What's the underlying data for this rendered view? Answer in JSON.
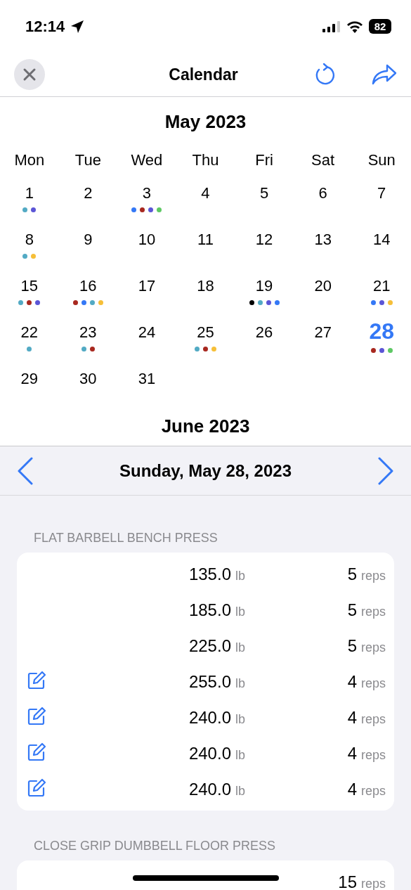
{
  "status_bar": {
    "time": "12:14",
    "battery": "82"
  },
  "nav": {
    "title": "Calendar"
  },
  "calendar": {
    "month": "May 2023",
    "weekdays": [
      "Mon",
      "Tue",
      "Wed",
      "Thu",
      "Fri",
      "Sat",
      "Sun"
    ],
    "days": [
      {
        "day": "1",
        "selected": false,
        "dots": [
          {
            "color": "#52aac4"
          },
          {
            "color": "#5b55d6"
          }
        ]
      },
      {
        "day": "2",
        "selected": false
      },
      {
        "day": "3",
        "selected": false,
        "dots": [
          {
            "color": "#3478f6"
          },
          {
            "color": "#a8281f"
          },
          {
            "color": "#5b55d6"
          },
          {
            "color": "#5ec864"
          }
        ]
      },
      {
        "day": "4",
        "selected": false
      },
      {
        "day": "5",
        "selected": false
      },
      {
        "day": "6",
        "selected": false
      },
      {
        "day": "7",
        "selected": false
      },
      {
        "day": "8",
        "selected": false,
        "dots": [
          {
            "color": "#52aac4"
          },
          {
            "color": "#f6bf38"
          }
        ]
      },
      {
        "day": "9",
        "selected": false
      },
      {
        "day": "10",
        "selected": false
      },
      {
        "day": "11",
        "selected": false
      },
      {
        "day": "12",
        "selected": false
      },
      {
        "day": "13",
        "selected": false
      },
      {
        "day": "14",
        "selected": false
      },
      {
        "day": "15",
        "selected": false,
        "dots": [
          {
            "color": "#52aac4"
          },
          {
            "color": "#a8281f"
          },
          {
            "color": "#5b55d6"
          }
        ]
      },
      {
        "day": "16",
        "selected": false,
        "dots": [
          {
            "color": "#a8281f"
          },
          {
            "color": "#3478f6"
          },
          {
            "color": "#52aac4"
          },
          {
            "color": "#f6bf38"
          }
        ]
      },
      {
        "day": "17",
        "selected": false
      },
      {
        "day": "18",
        "selected": false
      },
      {
        "day": "19",
        "selected": false,
        "dots": [
          {
            "color": "#000000"
          },
          {
            "color": "#52aac4"
          },
          {
            "color": "#5b55d6"
          },
          {
            "color": "#3478f6"
          }
        ]
      },
      {
        "day": "20",
        "selected": false
      },
      {
        "day": "21",
        "selected": false,
        "dots": [
          {
            "color": "#3478f6"
          },
          {
            "color": "#5b55d6"
          },
          {
            "color": "#f6bf38"
          }
        ]
      },
      {
        "day": "22",
        "selected": false,
        "dots": [
          {
            "color": "#52aac4"
          }
        ]
      },
      {
        "day": "23",
        "selected": false,
        "dots": [
          {
            "color": "#52aac4"
          },
          {
            "color": "#a8281f"
          }
        ]
      },
      {
        "day": "24",
        "selected": false
      },
      {
        "day": "25",
        "selected": false,
        "dots": [
          {
            "color": "#52aac4"
          },
          {
            "color": "#a8281f"
          },
          {
            "color": "#f6bf38"
          }
        ]
      },
      {
        "day": "26",
        "selected": false
      },
      {
        "day": "27",
        "selected": false
      },
      {
        "day": "28",
        "selected": true,
        "dots": [
          {
            "color": "#a8281f"
          },
          {
            "color": "#5b55d6"
          },
          {
            "color": "#5ec864"
          }
        ]
      },
      {
        "day": "29",
        "selected": false
      },
      {
        "day": "30",
        "selected": false
      },
      {
        "day": "31",
        "selected": false
      }
    ],
    "next_month": "June 2023"
  },
  "date_bar": {
    "date": "Sunday, May 28, 2023"
  },
  "exercises": [
    {
      "name": "FLAT BARBELL BENCH PRESS",
      "sets": [
        {
          "edited": false,
          "weight": "135.0",
          "weight_unit": "lb",
          "reps": "5",
          "reps_unit": "reps"
        },
        {
          "edited": false,
          "weight": "185.0",
          "weight_unit": "lb",
          "reps": "5",
          "reps_unit": "reps"
        },
        {
          "edited": false,
          "weight": "225.0",
          "weight_unit": "lb",
          "reps": "5",
          "reps_unit": "reps"
        },
        {
          "edited": true,
          "weight": "255.0",
          "weight_unit": "lb",
          "reps": "4",
          "reps_unit": "reps"
        },
        {
          "edited": true,
          "weight": "240.0",
          "weight_unit": "lb",
          "reps": "4",
          "reps_unit": "reps"
        },
        {
          "edited": true,
          "weight": "240.0",
          "weight_unit": "lb",
          "reps": "4",
          "reps_unit": "reps"
        },
        {
          "edited": true,
          "weight": "240.0",
          "weight_unit": "lb",
          "reps": "4",
          "reps_unit": "reps"
        }
      ]
    },
    {
      "name": "CLOSE GRIP DUMBBELL FLOOR PRESS",
      "sets": [
        {
          "edited": false,
          "reps": "15",
          "reps_unit": "reps"
        }
      ]
    }
  ]
}
